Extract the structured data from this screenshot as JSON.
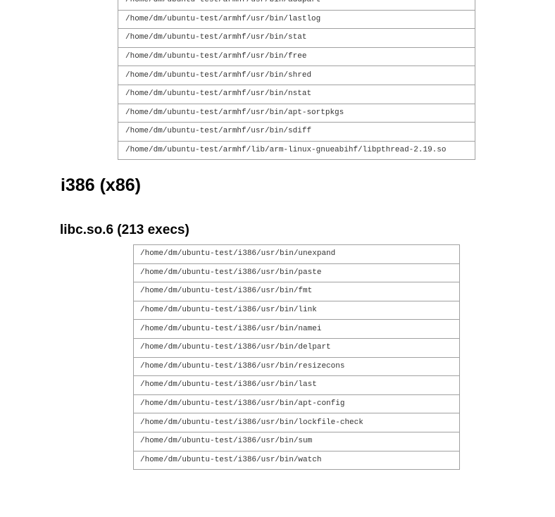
{
  "armhf_section": {
    "paths": [
      "/home/dm/ubuntu-test/armhf/usr/bin/addpart",
      "/home/dm/ubuntu-test/armhf/usr/bin/lastlog",
      "/home/dm/ubuntu-test/armhf/usr/bin/stat",
      "/home/dm/ubuntu-test/armhf/usr/bin/free",
      "/home/dm/ubuntu-test/armhf/usr/bin/shred",
      "/home/dm/ubuntu-test/armhf/usr/bin/nstat",
      "/home/dm/ubuntu-test/armhf/usr/bin/apt-sortpkgs",
      "/home/dm/ubuntu-test/armhf/usr/bin/sdiff",
      "/home/dm/ubuntu-test/armhf/lib/arm-linux-gnueabihf/libpthread-2.19.so"
    ]
  },
  "i386_section": {
    "arch_heading": "i386 (x86)",
    "lib_heading": "libc.so.6 (213 execs)",
    "paths": [
      "/home/dm/ubuntu-test/i386/usr/bin/unexpand",
      "/home/dm/ubuntu-test/i386/usr/bin/paste",
      "/home/dm/ubuntu-test/i386/usr/bin/fmt",
      "/home/dm/ubuntu-test/i386/usr/bin/link",
      "/home/dm/ubuntu-test/i386/usr/bin/namei",
      "/home/dm/ubuntu-test/i386/usr/bin/delpart",
      "/home/dm/ubuntu-test/i386/usr/bin/resizecons",
      "/home/dm/ubuntu-test/i386/usr/bin/last",
      "/home/dm/ubuntu-test/i386/usr/bin/apt-config",
      "/home/dm/ubuntu-test/i386/usr/bin/lockfile-check",
      "/home/dm/ubuntu-test/i386/usr/bin/sum",
      "/home/dm/ubuntu-test/i386/usr/bin/watch"
    ]
  }
}
